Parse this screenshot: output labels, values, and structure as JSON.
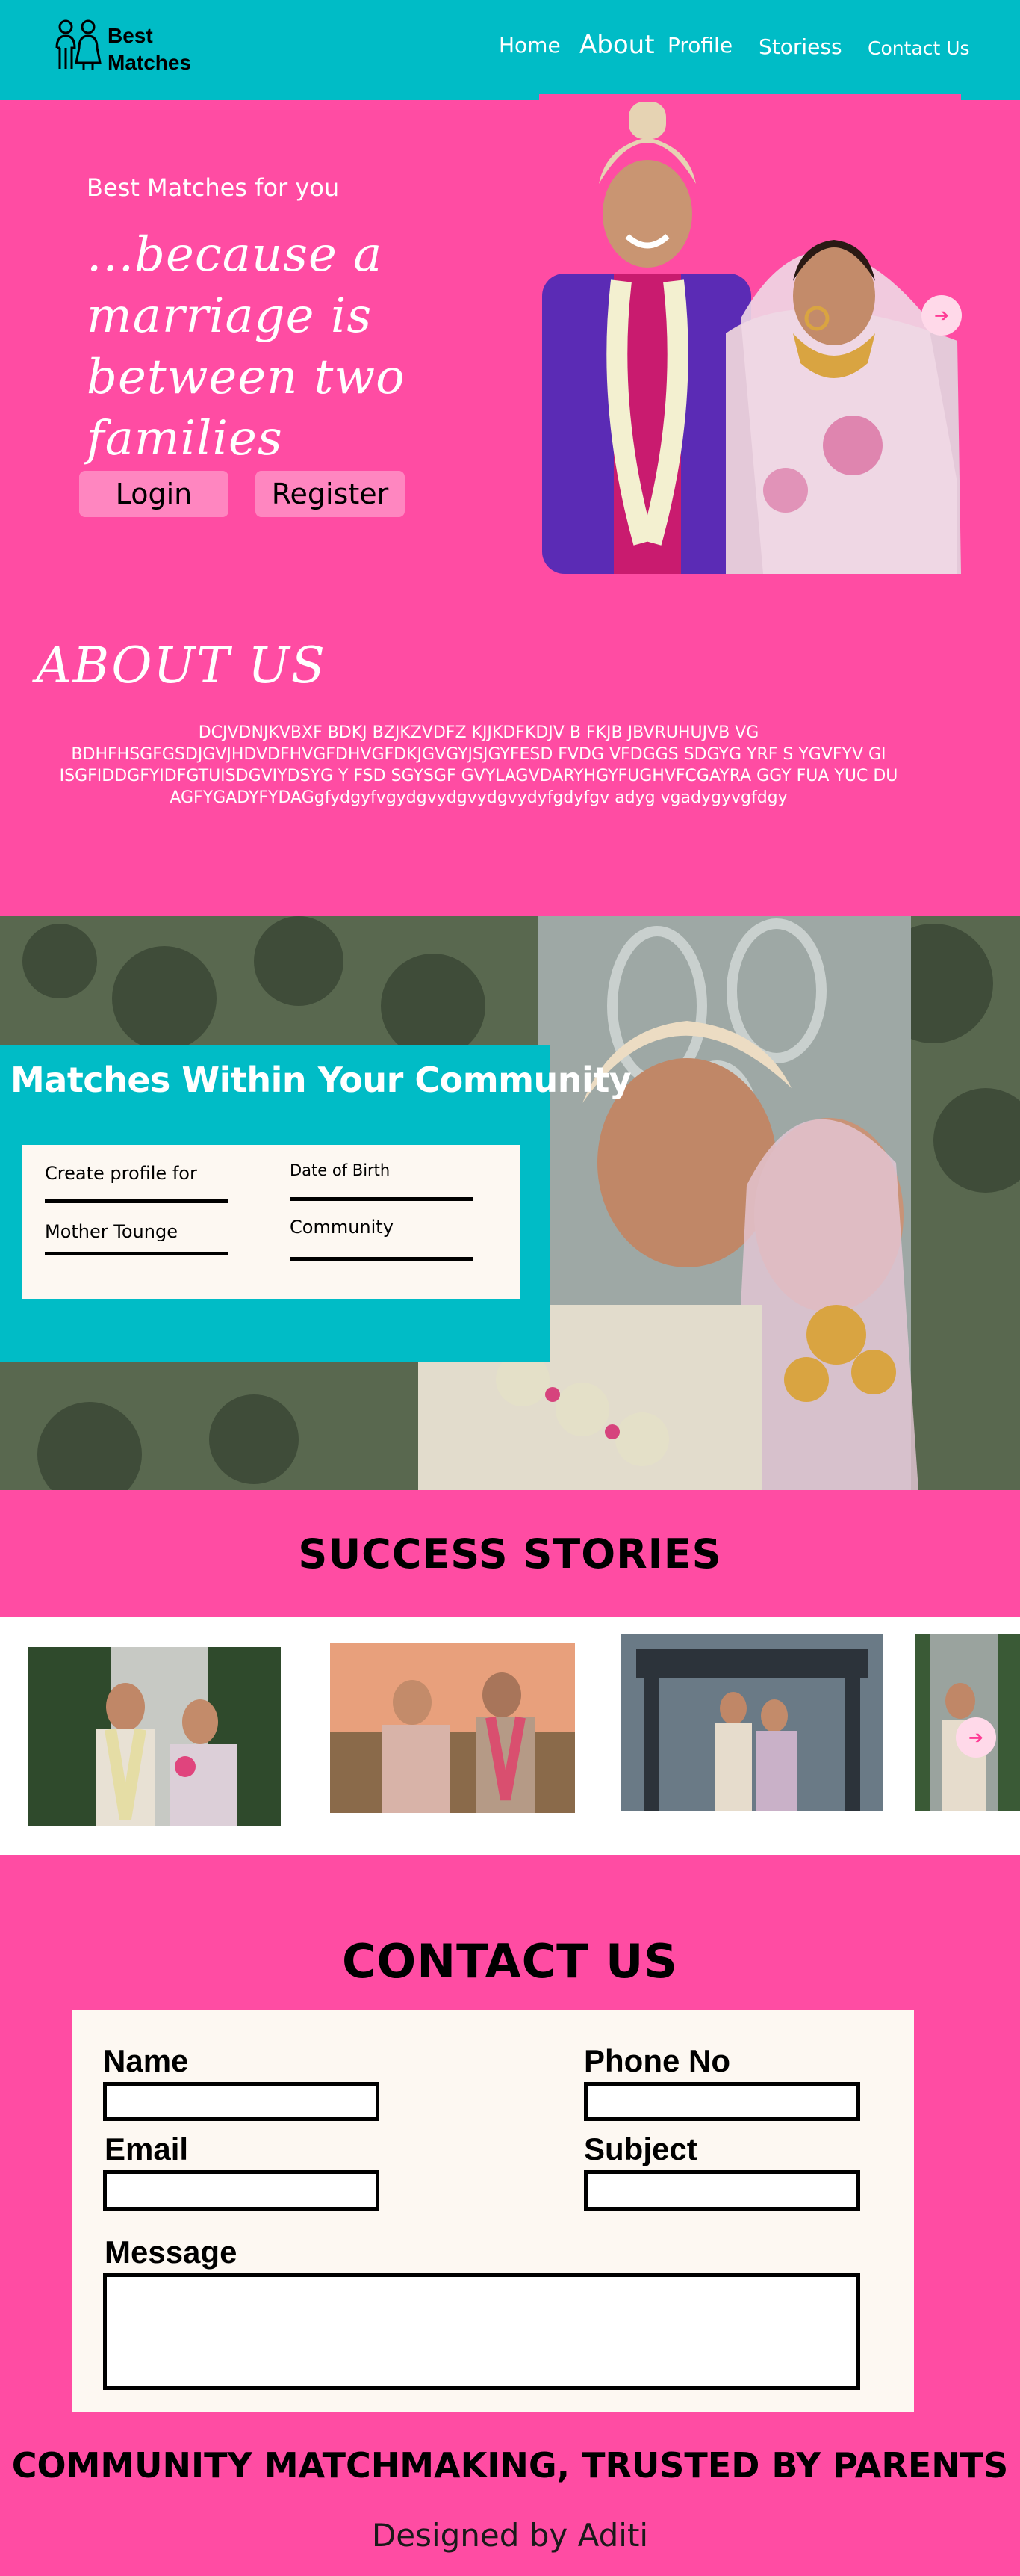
{
  "nav": {
    "brand_line1": "Best",
    "brand_line2": "Matches",
    "home": "Home",
    "about": "About",
    "profile": "Profile",
    "stories": "Storiess",
    "contact": "Contact Us"
  },
  "hero": {
    "subtitle": "Best Matches for you",
    "tagline": "...because a marriage is between two families",
    "login": "Login",
    "register": "Register",
    "next_arrow": "➔"
  },
  "about": {
    "title": "ABOUT US",
    "body": "DCJVDNJKVBXF BDKJ BZJKZVDFZ KJJKDFKDJV  B FKJB JBVRUHUJVB VG BDHFHSGFGSDJGVJHDVDFHVGFDHVGFDKJGVGYJSJGYFESD FVDG VFDGGS SDGYG YRF S YGVFYV GI ISGFIDDGFYIDFGTUISDGVIYDSYG Y FSD  SGYSGF  GVYLAGVDARYHGYFUGHVFCGAYRA GGY FUA YUC DU AGFYGADYFYDAGgfydgyfvgydgvydgvydgvydyfgdyfgv adyg vgadygyvgfdgy"
  },
  "community": {
    "title": "Matches Within Your Community",
    "create_profile_for": "Create profile for",
    "date_of_birth": "Date of Birth",
    "mother_tongue": "Mother Tounge",
    "community": "Community"
  },
  "success": {
    "title": "SUCCESS STORIES",
    "next_arrow": "➔"
  },
  "contact": {
    "title": "CONTACT US",
    "name": "Name",
    "phone": "Phone No",
    "email": "Email",
    "subject": "Subject",
    "message": "Message"
  },
  "footer": {
    "slogan": "COMMUNITY MATCHMAKING, TRUSTED BY PARENTS",
    "credit": "Designed by Aditi"
  },
  "colors": {
    "pink": "#ff4ca3",
    "teal": "#00bcc6",
    "cream": "#fdf8f2"
  }
}
